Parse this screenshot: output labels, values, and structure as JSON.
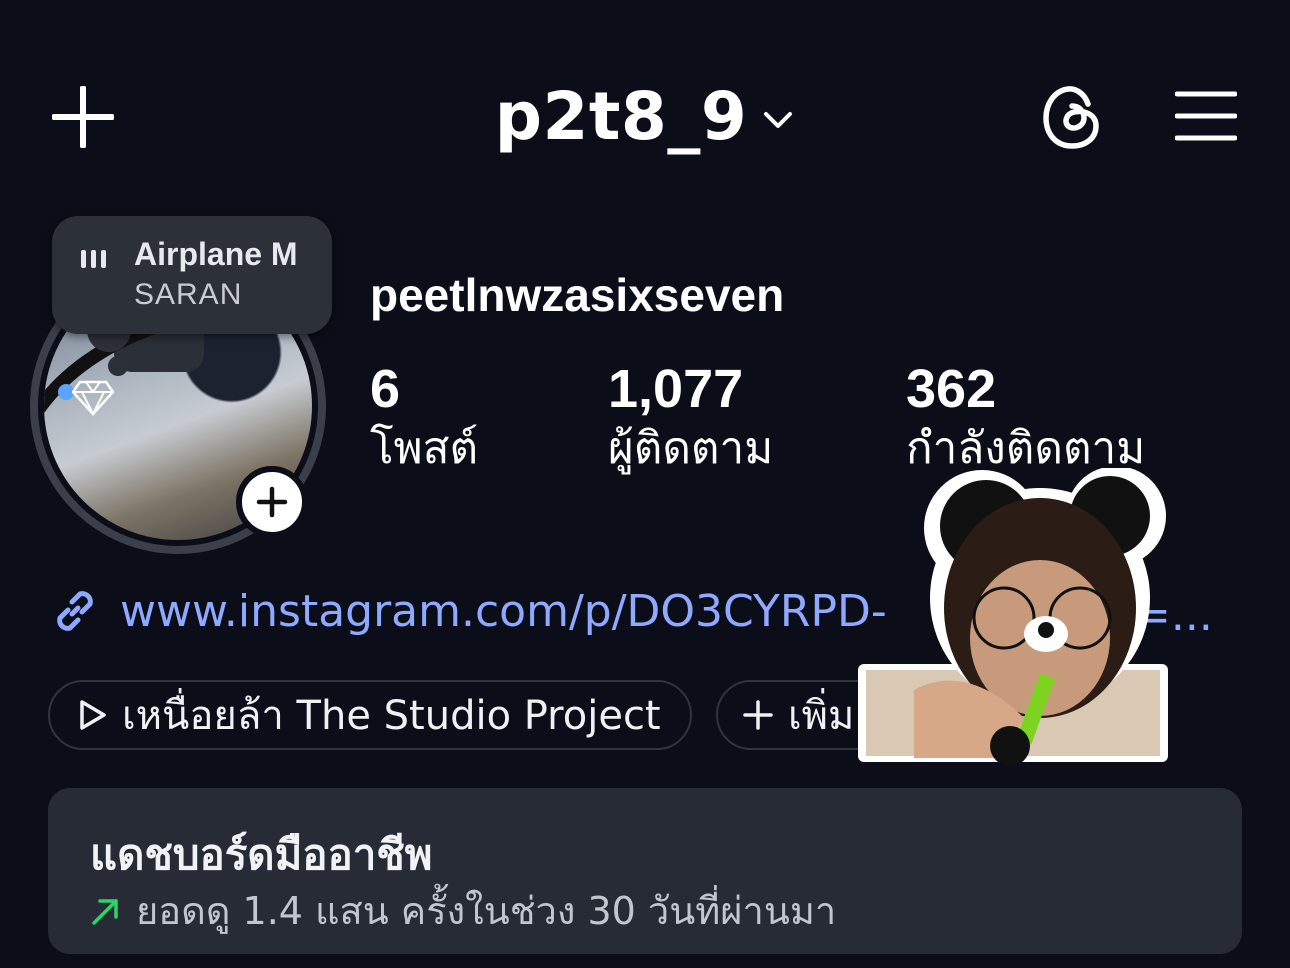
{
  "header": {
    "username": "p2t8_9"
  },
  "music": {
    "song": "Airplane M",
    "artist": "SARAN"
  },
  "profile": {
    "full_name": "peetlnwzasixseven"
  },
  "stats": [
    {
      "value": "6",
      "label": "โพสต์"
    },
    {
      "value": "1,077",
      "label": "ผู้ติดตาม"
    },
    {
      "value": "362",
      "label": "กำลังติดตาม"
    }
  ],
  "link": {
    "text": "www.instagram.com/p/DO3CYRPD-"
  },
  "chips": {
    "highlight": "เหนื่อยล้า The Studio Project",
    "add": "เพิ่ม"
  },
  "dashboard": {
    "title": "แดชบอร์ดมืออาชีพ",
    "subtitle": "ยอดดู 1.4 แสน ครั้งในช่วง 30 วันที่ผ่านมา"
  },
  "colors": {
    "background": "#0b0e19",
    "link": "#8ea9ff",
    "trend_up": "#2fd36b",
    "card": "#272b36"
  }
}
